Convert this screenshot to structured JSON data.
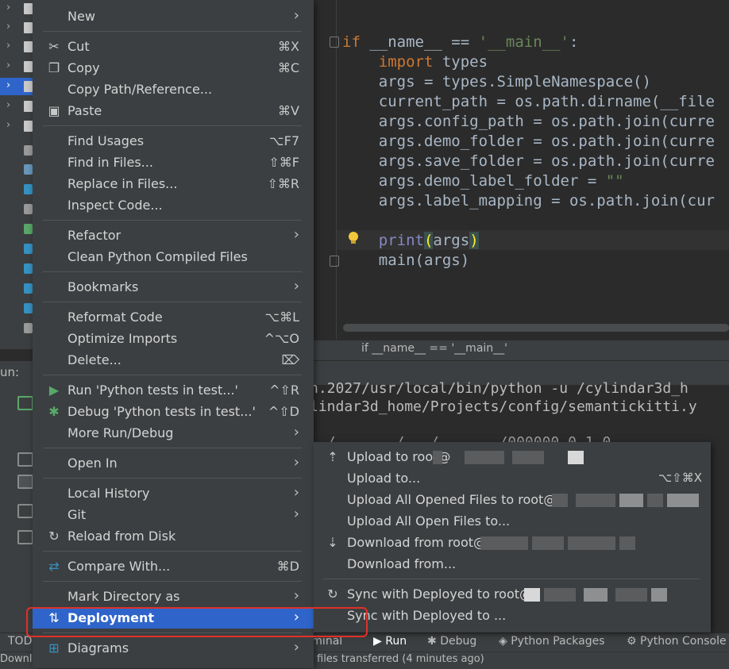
{
  "editor": {
    "lines": [
      {
        "parts": [
          {
            "t": "if",
            "c": "kw"
          },
          {
            "t": " __name__ == ",
            "c": ""
          },
          {
            "t": "'__main__'",
            "c": "str"
          },
          {
            "t": ":",
            "c": ""
          }
        ]
      },
      {
        "parts": [
          {
            "t": "    ",
            "c": ""
          },
          {
            "t": "import",
            "c": "kw"
          },
          {
            "t": " types",
            "c": ""
          }
        ]
      },
      {
        "parts": [
          {
            "t": "    args = types.SimpleNamespace()",
            "c": ""
          }
        ]
      },
      {
        "parts": [
          {
            "t": "    current_path = os.path.dirname(__file",
            "c": ""
          }
        ]
      },
      {
        "parts": [
          {
            "t": "    args.config_path = os.path.join(curre",
            "c": ""
          }
        ]
      },
      {
        "parts": [
          {
            "t": "    args.demo_folder = os.path.join(curre",
            "c": ""
          }
        ]
      },
      {
        "parts": [
          {
            "t": "    args.save_folder = os.path.join(curre",
            "c": ""
          }
        ]
      },
      {
        "parts": [
          {
            "t": "    args.demo_label_folder = ",
            "c": ""
          },
          {
            "t": "\"\"",
            "c": "str"
          }
        ]
      },
      {
        "parts": [
          {
            "t": "    args.label_mapping = os.path.join(cur",
            "c": ""
          }
        ]
      },
      {
        "parts": [
          {
            "t": "",
            "c": ""
          }
        ]
      },
      {
        "parts": [
          {
            "t": "    ",
            "c": ""
          },
          {
            "t": "print",
            "c": "bi"
          },
          {
            "t": "(",
            "c": "paren-hl"
          },
          {
            "t": "args",
            "c": ""
          },
          {
            "t": ")",
            "c": "paren-hl"
          }
        ]
      },
      {
        "parts": [
          {
            "t": "    main(args)",
            "c": ""
          }
        ]
      }
    ],
    "breadcrumb": "if __name__ == '__main__'"
  },
  "run": {
    "label": "un:",
    "output_lines": [
      "n.2027/usr/local/bin/python -u /cylindar3d_h",
      "lindar3d_home/Projects/config/semantickitti.y",
      "  /       /   /       /000000_0 1 0"
    ]
  },
  "context_menu": {
    "items": [
      {
        "label": "New",
        "shortcut": "",
        "submenu": true,
        "icon": "",
        "icon_name": ""
      },
      {
        "sep": true
      },
      {
        "label": "Cut",
        "shortcut": "⌘X",
        "submenu": false,
        "icon": "✂",
        "icon_name": "scissors-icon"
      },
      {
        "label": "Copy",
        "shortcut": "⌘C",
        "submenu": false,
        "icon": "❐",
        "icon_name": "copy-icon"
      },
      {
        "label": "Copy Path/Reference...",
        "shortcut": "",
        "submenu": false,
        "icon": "",
        "icon_name": ""
      },
      {
        "label": "Paste",
        "shortcut": "⌘V",
        "submenu": false,
        "icon": "▣",
        "icon_name": "clipboard-icon"
      },
      {
        "sep": true
      },
      {
        "label": "Find Usages",
        "shortcut": "⌥F7",
        "submenu": false,
        "icon": "",
        "icon_name": ""
      },
      {
        "label": "Find in Files...",
        "shortcut": "⇧⌘F",
        "submenu": false,
        "icon": "",
        "icon_name": ""
      },
      {
        "label": "Replace in Files...",
        "shortcut": "⇧⌘R",
        "submenu": false,
        "icon": "",
        "icon_name": ""
      },
      {
        "label": "Inspect Code...",
        "shortcut": "",
        "submenu": false,
        "icon": "",
        "icon_name": ""
      },
      {
        "sep": true
      },
      {
        "label": "Refactor",
        "shortcut": "",
        "submenu": true,
        "icon": "",
        "icon_name": ""
      },
      {
        "label": "Clean Python Compiled Files",
        "shortcut": "",
        "submenu": false,
        "icon": "",
        "icon_name": ""
      },
      {
        "sep": true
      },
      {
        "label": "Bookmarks",
        "shortcut": "",
        "submenu": true,
        "icon": "",
        "icon_name": ""
      },
      {
        "sep": true
      },
      {
        "label": "Reformat Code",
        "shortcut": "⌥⌘L",
        "submenu": false,
        "icon": "",
        "icon_name": ""
      },
      {
        "label": "Optimize Imports",
        "shortcut": "^⌥O",
        "submenu": false,
        "icon": "",
        "icon_name": ""
      },
      {
        "label": "Delete...",
        "shortcut": "⌦",
        "submenu": false,
        "icon": "",
        "icon_name": ""
      },
      {
        "sep": true
      },
      {
        "label": "Run 'Python tests in test...'",
        "shortcut": "^⇧R",
        "submenu": false,
        "icon": "▶",
        "icon_name": "run-icon",
        "icon_color": "#59a869"
      },
      {
        "label": "Debug 'Python tests in test...'",
        "shortcut": "^⇧D",
        "submenu": false,
        "icon": "✱",
        "icon_name": "debug-icon",
        "icon_color": "#59a869"
      },
      {
        "label": "More Run/Debug",
        "shortcut": "",
        "submenu": true,
        "icon": "",
        "icon_name": ""
      },
      {
        "sep": true
      },
      {
        "label": "Open In",
        "shortcut": "",
        "submenu": true,
        "icon": "",
        "icon_name": ""
      },
      {
        "sep": true
      },
      {
        "label": "Local History",
        "shortcut": "",
        "submenu": true,
        "icon": "",
        "icon_name": ""
      },
      {
        "label": "Git",
        "shortcut": "",
        "submenu": true,
        "icon": "",
        "icon_name": ""
      },
      {
        "label": "Reload from Disk",
        "shortcut": "",
        "submenu": false,
        "icon": "↻",
        "icon_name": "reload-icon"
      },
      {
        "sep": true
      },
      {
        "label": "Compare With...",
        "shortcut": "⌘D",
        "submenu": false,
        "icon": "⇄",
        "icon_name": "compare-icon",
        "icon_color": "#3592c4"
      },
      {
        "sep": true
      },
      {
        "label": "Mark Directory as",
        "shortcut": "",
        "submenu": true,
        "icon": "",
        "icon_name": ""
      },
      {
        "label": "Deployment",
        "shortcut": "",
        "submenu": true,
        "icon": "⇅",
        "icon_name": "deployment-icon",
        "active": true
      },
      {
        "sep": true
      },
      {
        "label": "Diagrams",
        "shortcut": "",
        "submenu": true,
        "icon": "⊞",
        "icon_name": "diagrams-icon",
        "icon_color": "#3592c4"
      }
    ]
  },
  "deployment_submenu": {
    "items": [
      {
        "label": "Upload to root@",
        "shortcut": "",
        "icon": "⇡",
        "icon_name": "upload-icon",
        "blur": "a"
      },
      {
        "label": "Upload to...",
        "shortcut": "⌥⇧⌘X",
        "icon": "",
        "icon_name": ""
      },
      {
        "label": "Upload All Opened Files to root@",
        "shortcut": "",
        "icon": "",
        "icon_name": "",
        "blur": "b"
      },
      {
        "label": "Upload All Open Files to...",
        "shortcut": "",
        "icon": "",
        "icon_name": ""
      },
      {
        "label": "Download from root@",
        "shortcut": "",
        "icon": "⇣",
        "icon_name": "download-icon",
        "blur": "c"
      },
      {
        "label": "Download from...",
        "shortcut": "",
        "icon": "",
        "icon_name": ""
      },
      {
        "sep": true
      },
      {
        "label": "Sync with Deployed to root@",
        "shortcut": "",
        "icon": "↻",
        "icon_name": "sync-icon",
        "blur": "d"
      },
      {
        "label": "Sync with Deployed to ...",
        "shortcut": "",
        "icon": "",
        "icon_name": ""
      }
    ]
  },
  "tool_windows": [
    {
      "label": "TODO",
      "name": "tool-window-todo"
    },
    {
      "label": "Terminal",
      "name": "tool-window-terminal"
    },
    {
      "label": "Run",
      "name": "tool-window-run"
    },
    {
      "label": "Debug",
      "name": "tool-window-debug"
    },
    {
      "label": "Python Packages",
      "name": "tool-window-python-packages"
    },
    {
      "label": "Python Console",
      "name": "tool-window-python-console"
    }
  ],
  "status": {
    "left": "Downlo",
    "message": "files transferred (4 minutes ago)"
  },
  "colors": {
    "selection": "#2f65ca",
    "highlight_box": "#e0302a",
    "keyword": "#cc7832",
    "string": "#6a8759"
  }
}
